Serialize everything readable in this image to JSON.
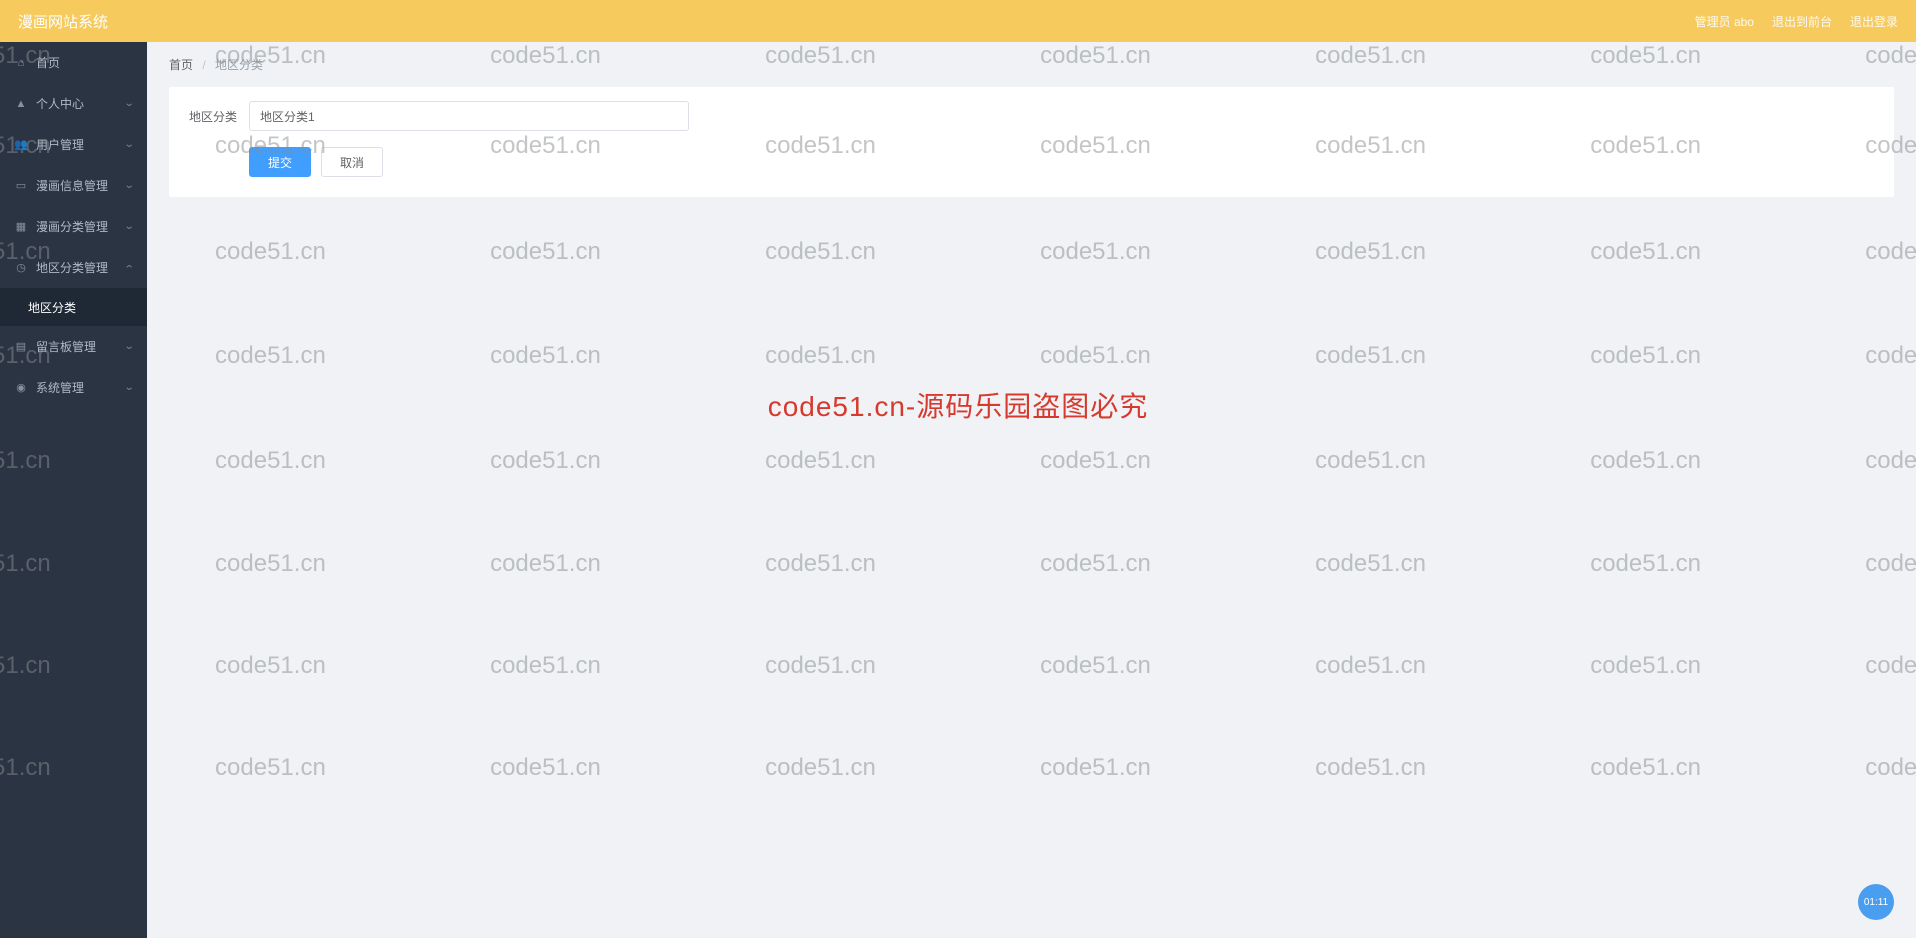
{
  "header": {
    "title": "漫画网站系统",
    "admin_label": "管理员 abo",
    "exit_back_label": "退出到前台",
    "logout_label": "退出登录"
  },
  "sidebar": {
    "items": [
      {
        "icon": "home",
        "label": "首页",
        "expandable": false
      },
      {
        "icon": "user",
        "label": "个人中心",
        "expandable": true,
        "expanded": false
      },
      {
        "icon": "users",
        "label": "用户管理",
        "expandable": true,
        "expanded": false
      },
      {
        "icon": "manga",
        "label": "漫画信息管理",
        "expandable": true,
        "expanded": false
      },
      {
        "icon": "grid",
        "label": "漫画分类管理",
        "expandable": true,
        "expanded": false
      },
      {
        "icon": "region",
        "label": "地区分类管理",
        "expandable": true,
        "expanded": true
      },
      {
        "icon": "board",
        "label": "留言板管理",
        "expandable": true,
        "expanded": false
      },
      {
        "icon": "system",
        "label": "系统管理",
        "expandable": true,
        "expanded": false
      }
    ],
    "submenu_label": "地区分类"
  },
  "breadcrumb": {
    "home": "首页",
    "current": "地区分类"
  },
  "form": {
    "label": "地区分类",
    "value": "地区分类1",
    "submit_label": "提交",
    "cancel_label": "取消"
  },
  "watermark": {
    "text": "code51.cn",
    "center_text": "code51.cn-源码乐园盗图必究"
  },
  "fab": {
    "text": "01:11"
  }
}
